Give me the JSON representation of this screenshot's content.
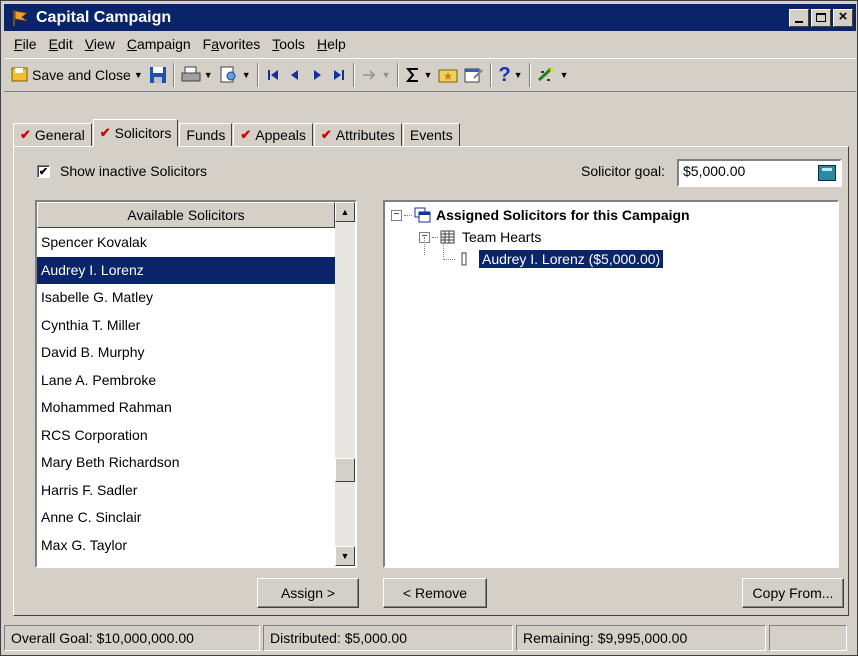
{
  "window": {
    "title": "Capital Campaign"
  },
  "menu": [
    {
      "label": "File",
      "key": "F",
      "rest": "ile"
    },
    {
      "label": "Edit",
      "key": "E",
      "rest": "dit"
    },
    {
      "label": "View",
      "key": "V",
      "rest": "iew"
    },
    {
      "label": "Campaign",
      "key": "C",
      "rest": "ampaign"
    },
    {
      "label": "Favorites",
      "key": "a",
      "pre": "F",
      "rest": "vorites"
    },
    {
      "label": "Tools",
      "key": "T",
      "rest": "ools"
    },
    {
      "label": "Help",
      "key": "H",
      "rest": "elp"
    }
  ],
  "toolbar": {
    "save_close_label": "Save and Close"
  },
  "tabs": [
    {
      "label": "General",
      "checked": true,
      "active": false
    },
    {
      "label": "Solicitors",
      "checked": true,
      "active": true
    },
    {
      "label": "Funds",
      "checked": false,
      "active": false
    },
    {
      "label": "Appeals",
      "checked": true,
      "active": false
    },
    {
      "label": "Attributes",
      "checked": true,
      "active": false
    },
    {
      "label": "Events",
      "checked": false,
      "active": false
    }
  ],
  "options": {
    "show_inactive_label": "Show inactive Solicitors",
    "show_inactive_checked": true
  },
  "goal": {
    "label": "Solicitor goal:",
    "value": "$5,000.00"
  },
  "available": {
    "header": "Available Solicitors",
    "items": [
      "Spencer Kovalak",
      "Audrey I. Lorenz",
      "Isabelle G. Matley",
      "Cynthia T. Miller",
      "David B. Murphy",
      "Lane A. Pembroke",
      "Mohammed Rahman",
      "RCS Corporation",
      "Mary Beth Richardson",
      "Harris F. Sadler",
      "Anne C. Sinclair",
      "Max G. Taylor"
    ],
    "selected_index": 1
  },
  "tree": {
    "root": "Assigned Solicitors for this Campaign",
    "team": "Team Hearts",
    "member": "Audrey I. Lorenz ($5,000.00)"
  },
  "buttons": {
    "assign": "Assign >",
    "remove": "< Remove",
    "copy_from": "Copy From..."
  },
  "status": {
    "overall": "Overall Goal: $10,000,000.00",
    "distributed": "Distributed: $5,000.00",
    "remaining": "Remaining: $9,995,000.00"
  }
}
